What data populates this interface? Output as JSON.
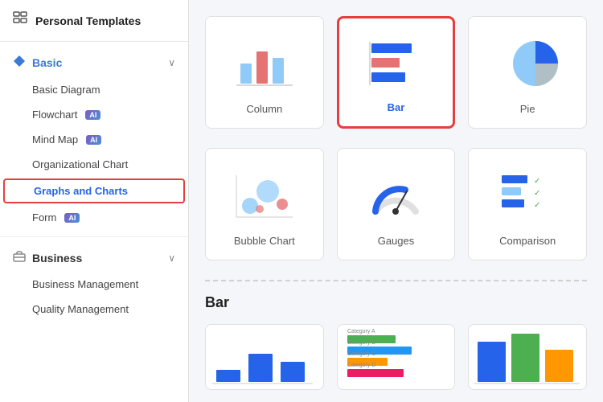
{
  "sidebar": {
    "header": {
      "title": "Personal Templates",
      "icon": "grid-icon"
    },
    "basic_section": {
      "label": "Basic",
      "icon": "diamond-icon",
      "items": [
        {
          "id": "basic-diagram",
          "label": "Basic Diagram",
          "ai": false,
          "active": false
        },
        {
          "id": "flowchart",
          "label": "Flowchart",
          "ai": true,
          "active": false
        },
        {
          "id": "mind-map",
          "label": "Mind Map",
          "ai": true,
          "active": false
        },
        {
          "id": "org-chart",
          "label": "Organizational Chart",
          "ai": false,
          "active": false
        },
        {
          "id": "graphs-charts",
          "label": "Graphs and Charts",
          "ai": false,
          "active": true
        },
        {
          "id": "form",
          "label": "Form",
          "ai": true,
          "active": false
        }
      ]
    },
    "business_section": {
      "label": "Business",
      "icon": "briefcase-icon",
      "items": [
        {
          "id": "business-mgmt",
          "label": "Business Management",
          "ai": false,
          "active": false
        },
        {
          "id": "quality-mgmt",
          "label": "Quality Management",
          "ai": false,
          "active": false
        }
      ]
    }
  },
  "main": {
    "top_cards": [
      {
        "id": "column",
        "label": "Column",
        "selected": false
      },
      {
        "id": "bar",
        "label": "Bar",
        "selected": true
      },
      {
        "id": "pie",
        "label": "Pie",
        "selected": false
      }
    ],
    "bottom_row_top": [
      {
        "id": "bubble",
        "label": "Bubble Chart",
        "selected": false
      },
      {
        "id": "gauges",
        "label": "Gauges",
        "selected": false
      },
      {
        "id": "comparison",
        "label": "Comparison",
        "selected": false
      }
    ],
    "section_title": "Bar",
    "bottom_cards": [
      {
        "id": "bar-1",
        "label": ""
      },
      {
        "id": "bar-2",
        "label": ""
      },
      {
        "id": "bar-3",
        "label": ""
      }
    ]
  },
  "colors": {
    "blue_primary": "#2563eb",
    "blue_light": "#93c5fd",
    "red_accent": "#e53e3e",
    "bar_blue": "#2563eb",
    "bar_red": "#e57373",
    "bar_lightblue": "#90caf9"
  }
}
